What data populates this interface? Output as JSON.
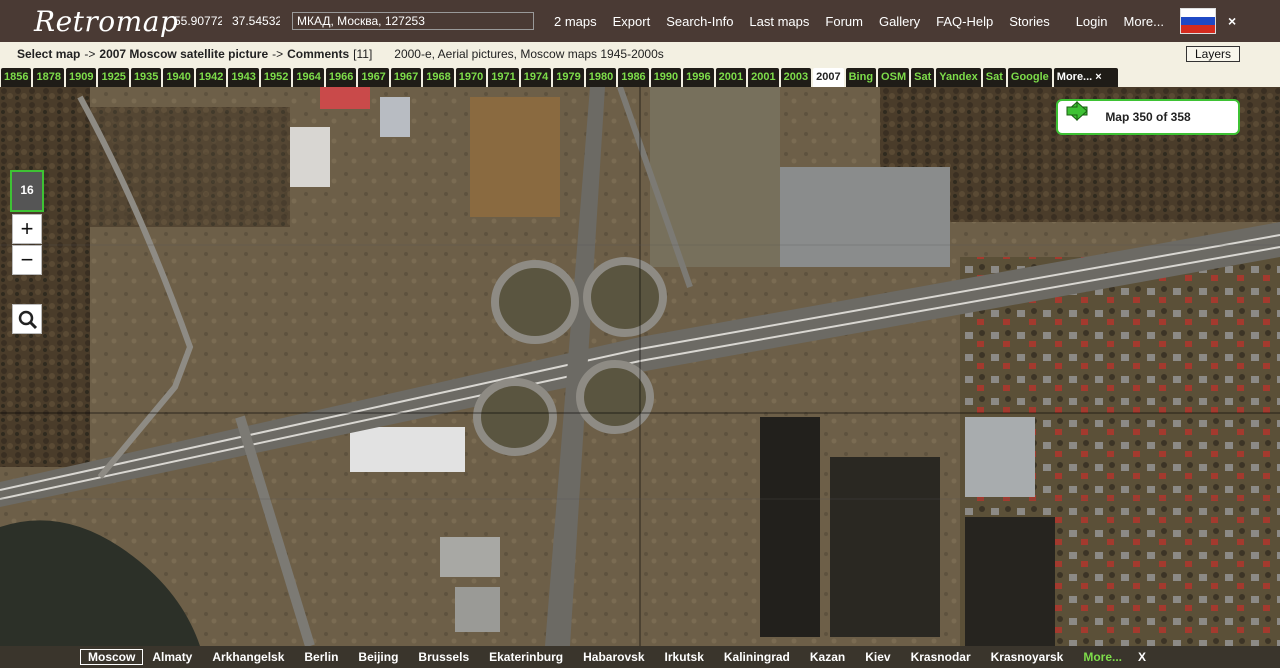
{
  "header": {
    "logo": "Retromap",
    "lat": "55.90772",
    "lon": "37.54532",
    "address": "МКАД, Москва, 127253",
    "nav": [
      "2 maps",
      "Export",
      "Search-Info",
      "Last maps",
      "Forum",
      "Gallery",
      "FAQ-Help",
      "Stories"
    ],
    "login": "Login",
    "more": "More...",
    "close": "×"
  },
  "breadcrumb": {
    "select": "Select map",
    "arrow": "->",
    "map_title": "2007 Moscow satellite picture",
    "comments_label": "Comments",
    "comments_count": "[11]",
    "description": "2000-e, Aerial pictures, Moscow maps 1945-2000s",
    "layers_button": "Layers"
  },
  "year_tabs": [
    "1856",
    "1878",
    "1909",
    "1925",
    "1935",
    "1940",
    "1942",
    "1943",
    "1952",
    "1964",
    "1966",
    "1967",
    "1967",
    "1968",
    "1970",
    "1971",
    "1974",
    "1979",
    "1980",
    "1986",
    "1990",
    "1996",
    "2001",
    "2001",
    "2003",
    "2007",
    "Bing",
    "OSM",
    "Sat",
    "Yandex",
    "Sat",
    "Google",
    "More...  ×"
  ],
  "active_year_index": 25,
  "map_controls": {
    "zoom_level": "16",
    "zoom_in": "+",
    "zoom_out": "−",
    "map_counter": "Map 350 of 358"
  },
  "cities": {
    "items": [
      "Moscow",
      "Almaty",
      "Arkhangelsk",
      "Berlin",
      "Beijing",
      "Brussels",
      "Ekaterinburg",
      "Habarovsk",
      "Irkutsk",
      "Kaliningrad",
      "Kazan",
      "Kiev",
      "Krasnodar",
      "Krasnoyarsk"
    ],
    "active_index": 0,
    "more": "More...",
    "close": "X"
  },
  "colors": {
    "header_bg": "#4a3a34",
    "accent_green": "#3ec234",
    "tab_text_green": "#7ddc4a",
    "crumb_bg": "#f3f0e2"
  }
}
